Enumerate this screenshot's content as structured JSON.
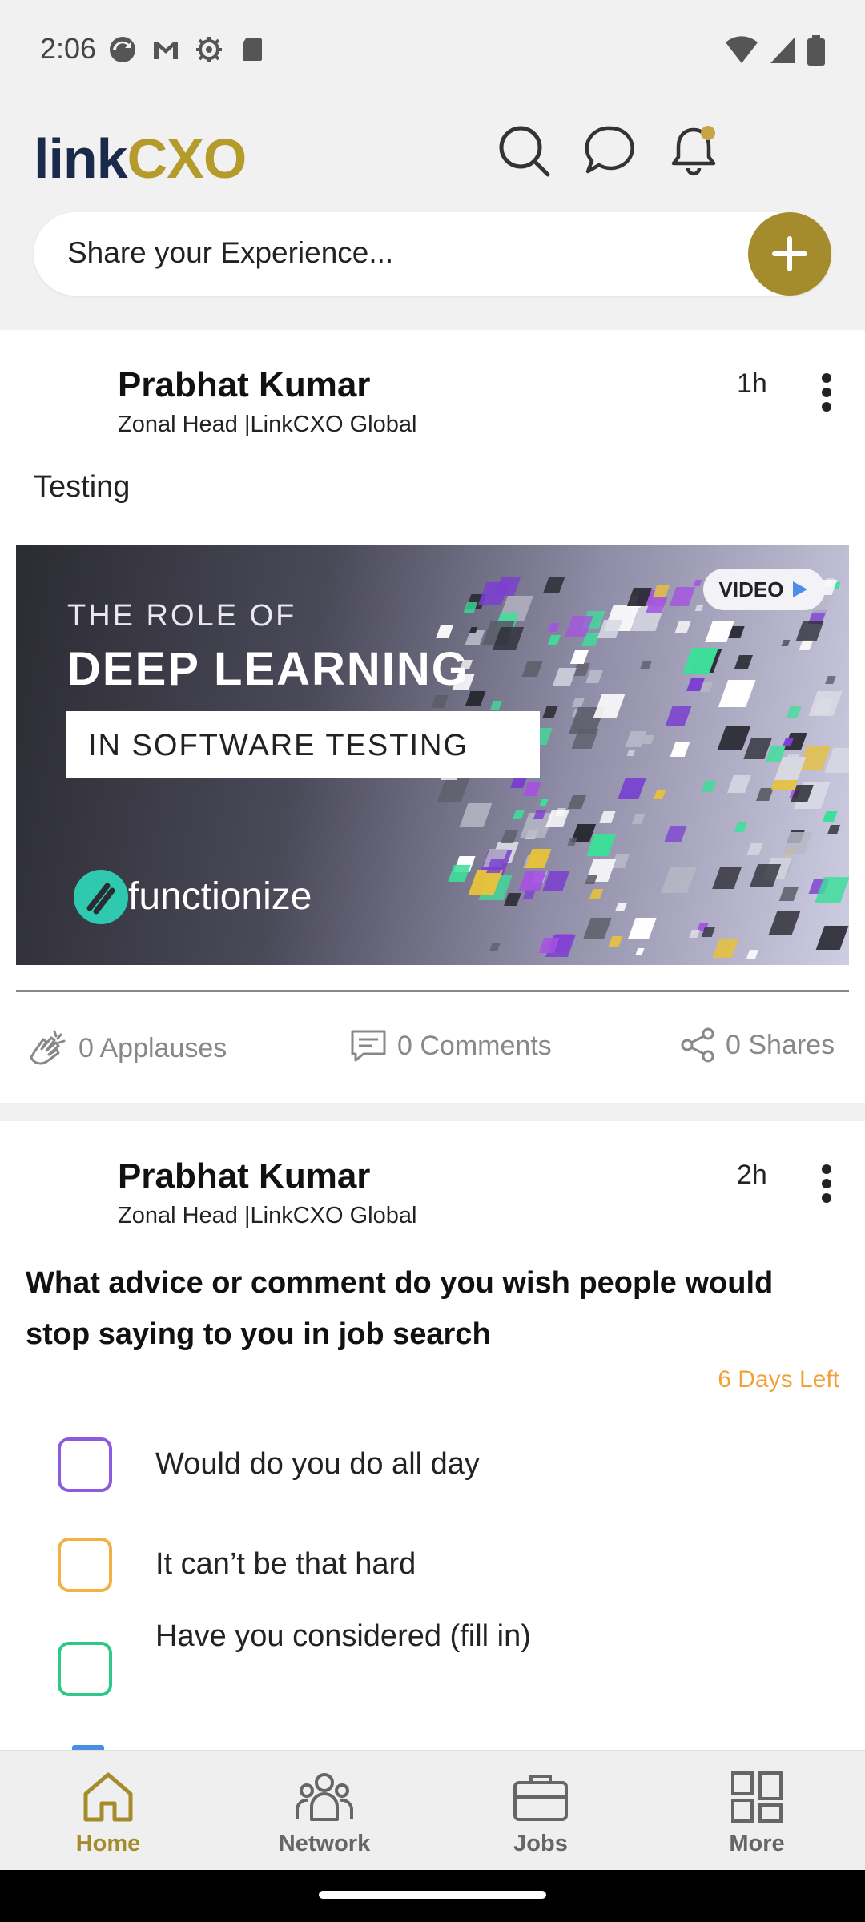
{
  "status_bar": {
    "time": "2:06",
    "left_icons": [
      "sync-icon",
      "gmail-icon",
      "settings-icon",
      "sd-card-icon"
    ],
    "right_icons": [
      "wifi-icon",
      "signal-icon",
      "battery-icon"
    ]
  },
  "header": {
    "logo_link": "link",
    "logo_cxo": "CXO",
    "icons": [
      "search-icon",
      "chat-icon",
      "bell-icon"
    ]
  },
  "composer": {
    "placeholder": "Share your Experience..."
  },
  "colors": {
    "brand_gold": "#a48c2c",
    "poll_deadline": "#f0a23a",
    "opt1": "#8c5ce0",
    "opt2": "#f2b145",
    "opt3": "#2ec98a"
  },
  "posts": [
    {
      "author": "Prabhat Kumar",
      "title": "Zonal Head |LinkCXO Global",
      "time": "1h",
      "text": "Testing",
      "media": {
        "line1": "THE ROLE OF",
        "line2": "DEEP LEARNING",
        "line3": "IN SOFTWARE TESTING",
        "badge": "VIDEO",
        "brand": "functionize"
      },
      "applauses": "0 Applauses",
      "comments": "0 Comments",
      "shares": "0 Shares"
    },
    {
      "author": "Prabhat Kumar",
      "title": "Zonal Head |LinkCXO Global",
      "time": "2h",
      "poll": {
        "question": "What advice or comment do you wish people would stop saying to you in job search",
        "days_left": "6 Days Left",
        "options": [
          "Would do you do all day",
          "It can’t be that hard",
          "Have you considered (fill in)"
        ]
      }
    }
  ],
  "nav": {
    "home": "Home",
    "network": "Network",
    "jobs": "Jobs",
    "more": "More"
  }
}
